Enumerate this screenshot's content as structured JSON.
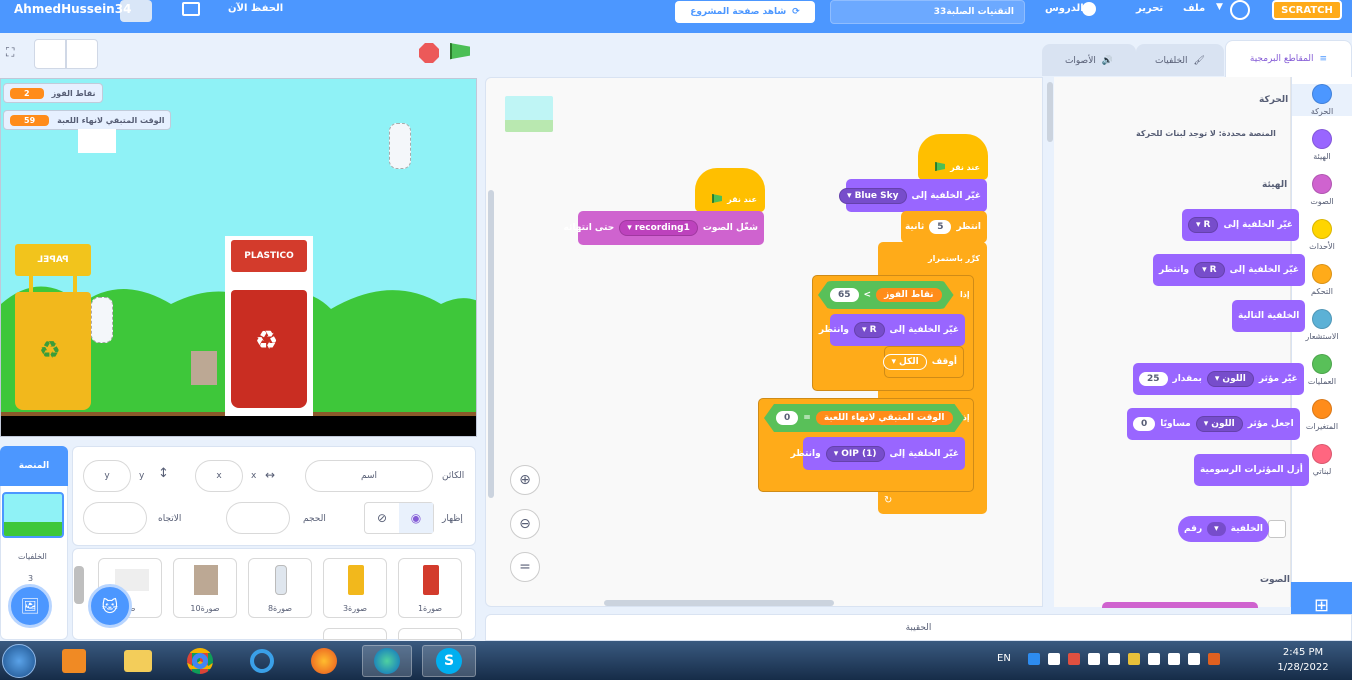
{
  "menu": {
    "username": "AhmedHussein34",
    "save_now": "الحفظ الآن",
    "see_project_page": "شاهد صفحة المشروع",
    "project_title": "33التقنيات الصلبة",
    "tutorials": "الدروس",
    "edit": "تحرير",
    "file": "ملف",
    "logo": "SCRATCH"
  },
  "tabs": {
    "code": "المقاطع البرمجية",
    "backdrops": "الخلفيات",
    "sounds": "الأصوات"
  },
  "stage_monitors": [
    {
      "label": "نقاط الفوز",
      "value": "2"
    },
    {
      "label": "الوقت المتبقي لانهاء اللعبة",
      "value": "59"
    }
  ],
  "stage_sprites": {
    "paper_bin": "PAPEL",
    "plastic_bin": "PLASTICO"
  },
  "categories": [
    {
      "label": "الحركة",
      "color": "#4c97ff"
    },
    {
      "label": "الهيئة",
      "color": "#9966ff"
    },
    {
      "label": "الصوت",
      "color": "#cf63cf"
    },
    {
      "label": "الأحداث",
      "color": "#ffd500"
    },
    {
      "label": "التحكم",
      "color": "#ffab19"
    },
    {
      "label": "الاستشعار",
      "color": "#5cb1d6"
    },
    {
      "label": "العمليات",
      "color": "#59c059"
    },
    {
      "label": "المتغيرات",
      "color": "#ff8c1a"
    },
    {
      "label": "لبناتي",
      "color": "#ff6680"
    }
  ],
  "palette": {
    "motion_heading": "الحركة",
    "motion_note": "المنصة محددة: لا توجد لبنات للحركة",
    "looks_heading": "الهيئة",
    "sound_heading": "الصوت",
    "switch_backdrop": "غيّر الخلفية إلى",
    "switch_backdrop_wait": "غيّر الخلفية إلى",
    "and_wait": "وانتظر",
    "next_backdrop": "الخلفية التالية",
    "change_effect": "غيّر مؤثر",
    "by": "بمقدار",
    "set_effect": "اجعل مؤثر",
    "equal_to": "مساويًا",
    "clear_effects": "أزل المؤثرات الرسومية",
    "backdrop_number": "رقم",
    "backdrop_word": "الخلفية",
    "color_opt": "اللون",
    "r_opt": "R",
    "val_25": "25",
    "val_0": "0"
  },
  "scripts": {
    "when_flag": "عند نقر",
    "play_sound": "شغّل الصوت",
    "until_done": "حتى انتهائه",
    "sound_name": "recording1",
    "switch_to": "غيّر الخلفية إلى",
    "blue_sky": "Blue Sky",
    "wait": "انتظر",
    "seconds": "ثانية",
    "wait_val": "5",
    "forever": "كرِّر باستمرار",
    "if": "إذا",
    "score_var": "نقاط الفوز",
    "gt": ">",
    "val_65": "65",
    "r_opt": "R",
    "and_wait": "وانتظر",
    "stop": "أوقف",
    "all": "الكل",
    "timer_var": "الوقت المتبقي لانهاء اللعبة",
    "eq": "=",
    "val_0": "0",
    "oip": "OIP (1)",
    "backpack": "الحقيبة"
  },
  "sprite_info": {
    "sprite_label": "الكائن",
    "name_placeholder": "اسم",
    "x_label": "x",
    "x_val": "x",
    "y_label": "y",
    "y_val": "y",
    "show_label": "إظهار",
    "size_label": "الحجم",
    "direction_label": "الاتجاه"
  },
  "stage_panel": {
    "title": "المنصة",
    "backdrops_label": "الخلفيات",
    "backdrops_count": "3"
  },
  "sprites": [
    {
      "name": "صورة1",
      "color": "#d33b2c"
    },
    {
      "name": "صورة3",
      "color": "#f2b81c"
    },
    {
      "name": "صورة8",
      "color": "#dfe6ee"
    },
    {
      "name": "صورة10",
      "color": "#bca894"
    },
    {
      "name": "صو",
      "color": "#eeeeee"
    }
  ],
  "taskbar": {
    "lang": "EN",
    "time": "2:45 PM",
    "date": "1/28/2022"
  }
}
